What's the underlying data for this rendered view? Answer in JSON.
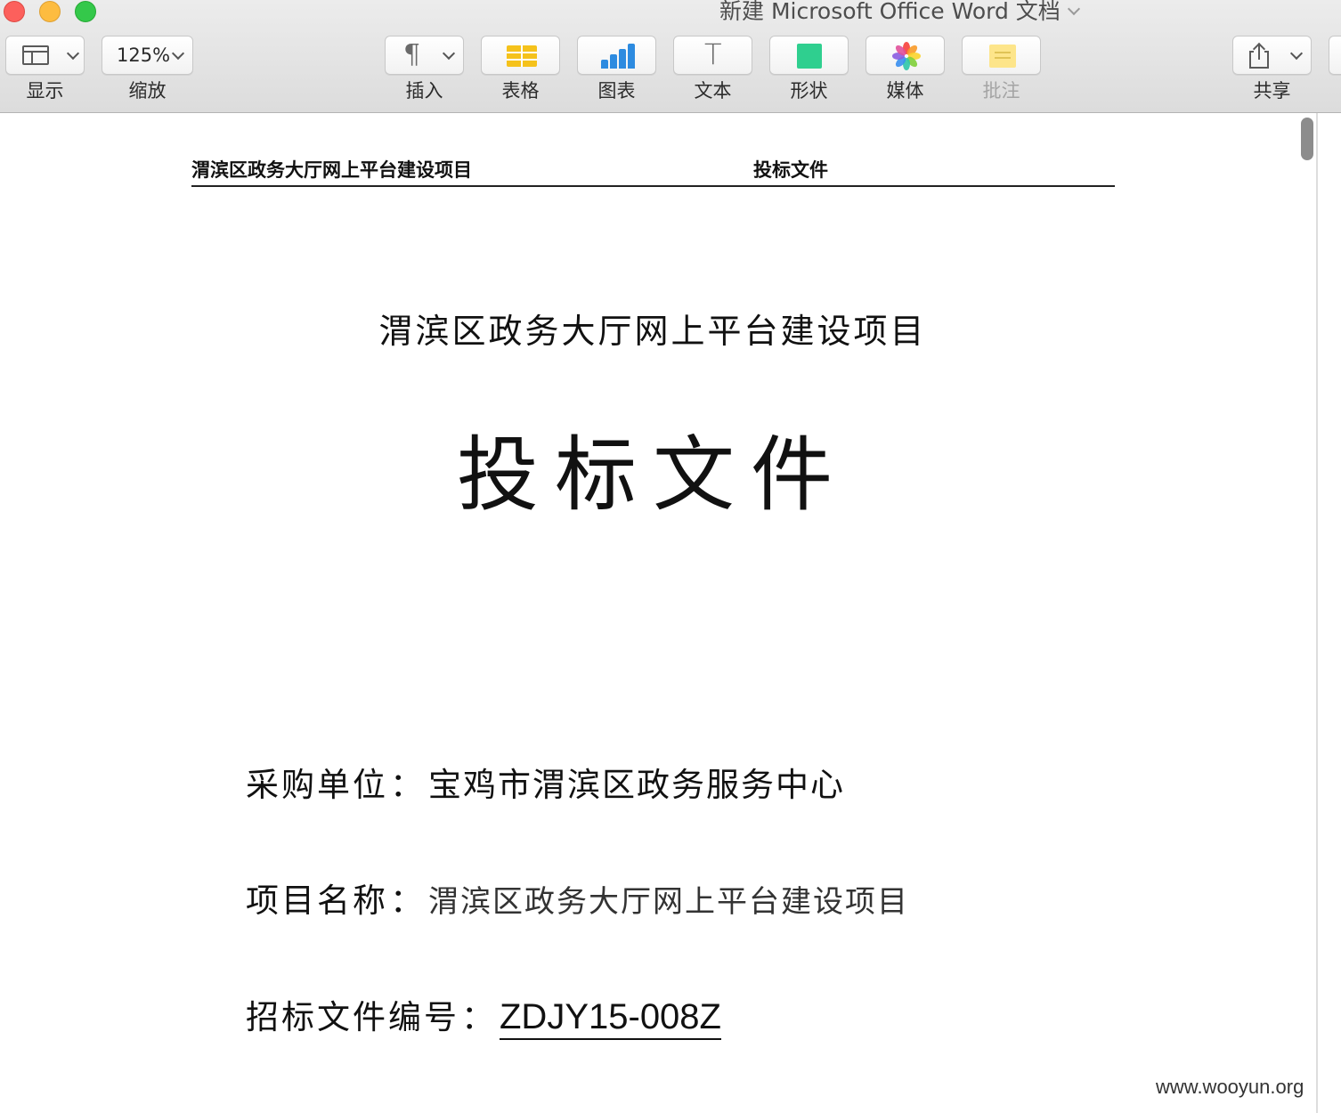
{
  "window": {
    "title": "新建 Microsoft Office Word 文档"
  },
  "toolbar": {
    "view_label": "显示",
    "zoom_value": "125%",
    "zoom_label": "缩放",
    "insert_label": "插入",
    "table_label": "表格",
    "chart_label": "图表",
    "text_label": "文本",
    "shape_label": "形状",
    "media_label": "媒体",
    "comment_label": "批注",
    "share_label": "共享"
  },
  "document": {
    "header_left": "渭滨区政务大厅网上平台建设项目",
    "header_right": "投标文件",
    "title": "渭滨区政务大厅网上平台建设项目",
    "main_title": "投标文件",
    "fields": [
      {
        "label": "采购单位",
        "colon": "：",
        "value": "宝鸡市渭滨区政务服务中心"
      },
      {
        "label": "项目名称",
        "colon": "：",
        "value": "渭滨区政务大厅网上平台建设项目"
      },
      {
        "label": "招标文件编号",
        "colon": "：",
        "value": "ZDJY15-008Z"
      }
    ]
  },
  "watermark": "www.wooyun.org",
  "colors": {
    "close": "#fc605c",
    "minimize": "#fdbc40",
    "maximize": "#34c84a",
    "chart_icon": "#2d8be0",
    "table_icon": "#f5c21b",
    "shape_icon": "#2fcf8f",
    "comment_icon": "#fde58a"
  },
  "icons": [
    "view-icon",
    "paragraph-icon",
    "table-icon",
    "chart-icon",
    "text-icon",
    "shape-icon",
    "photos-icon",
    "comment-icon",
    "share-icon"
  ]
}
